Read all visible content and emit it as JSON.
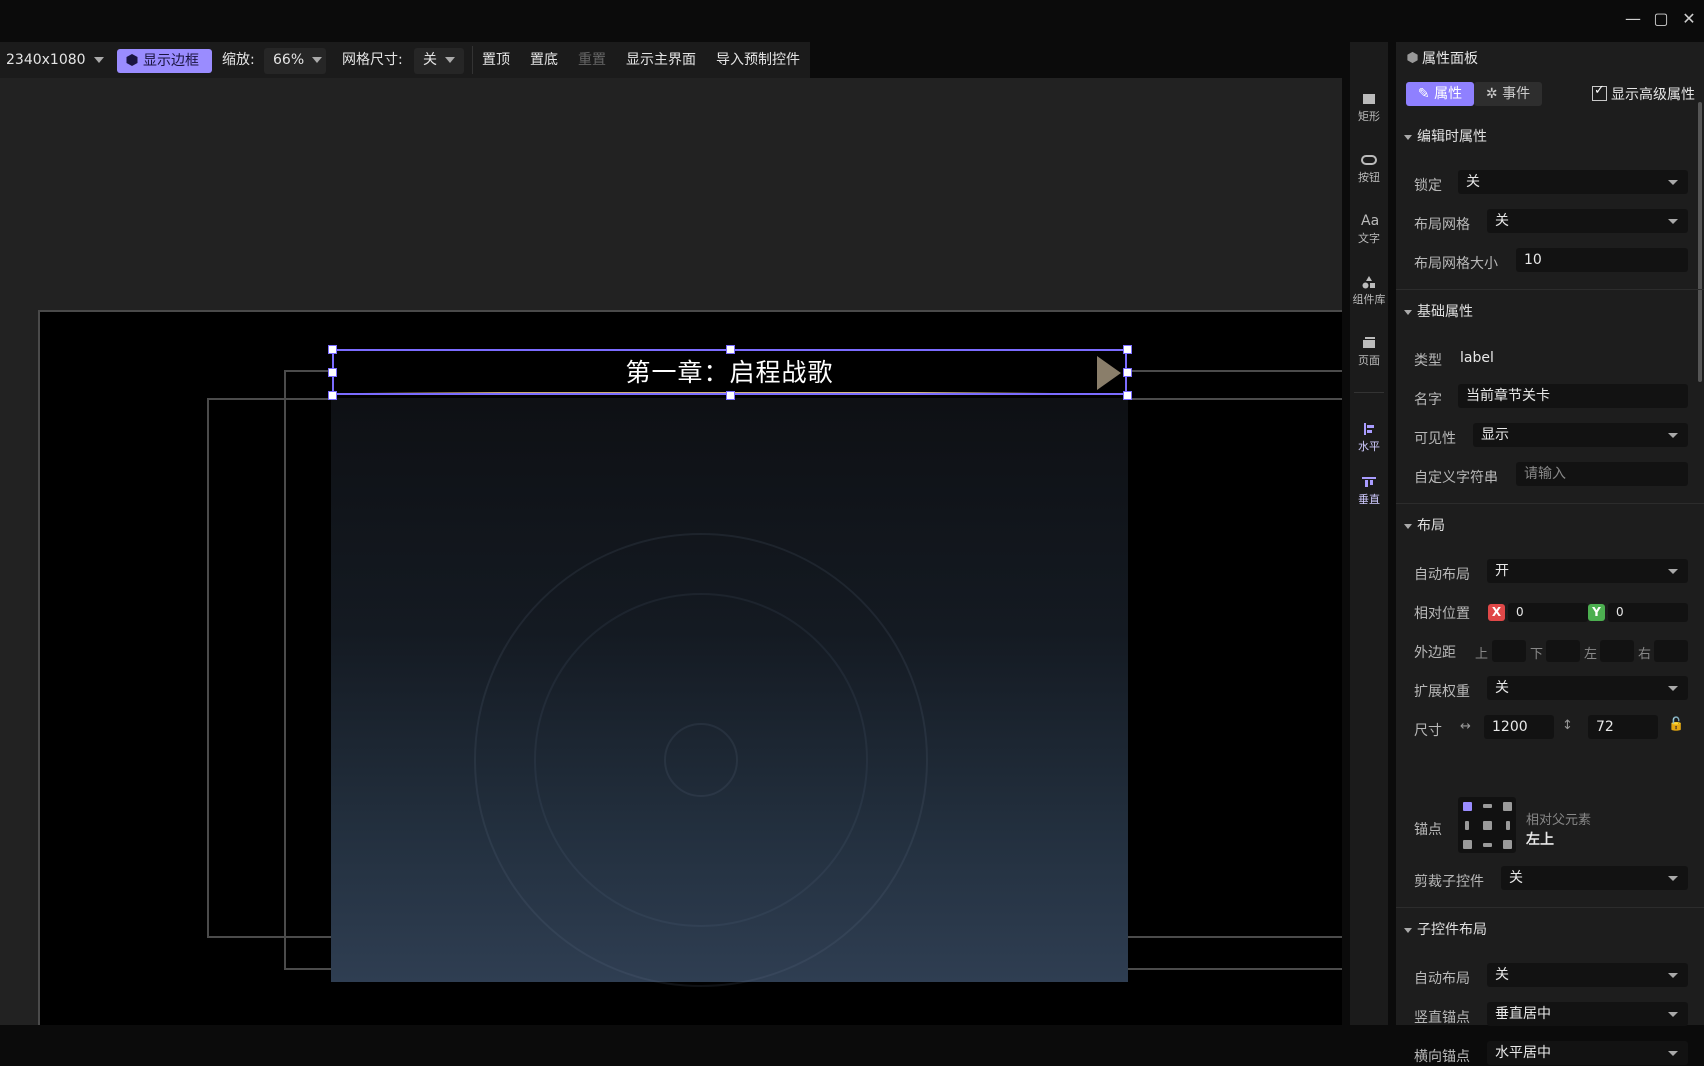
{
  "window": {
    "minimize": "—",
    "maximize": "▢",
    "close": "✕"
  },
  "toolbar": {
    "resolution": "2340x1080",
    "show_border": "显示边框",
    "zoom_label": "缩放:",
    "zoom_value": "66%",
    "grid_label": "网格尺寸:",
    "grid_value": "关",
    "bring_top": "置顶",
    "send_bottom": "置底",
    "reset": "重置",
    "show_main": "显示主界面",
    "import_prefab": "导入预制控件"
  },
  "canvas": {
    "title": "第一章：启程战歌"
  },
  "rail": {
    "rect": "矩形",
    "button": "按钮",
    "text": "文字",
    "library": "组件库",
    "page": "页面",
    "horizontal": "水平",
    "vertical": "垂直"
  },
  "props": {
    "title": "属性面板",
    "tab_props": "属性",
    "tab_events": "事件",
    "show_advanced": "显示高级属性",
    "edit": {
      "heading": "编辑时属性",
      "lock_label": "锁定",
      "lock_value": "关",
      "grid_label": "布局网格",
      "grid_value": "关",
      "grid_size_label": "布局网格大小",
      "grid_size_value": "10"
    },
    "basic": {
      "heading": "基础属性",
      "type_label": "类型",
      "type_value": "label",
      "name_label": "名字",
      "name_value": "当前章节关卡",
      "visible_label": "可见性",
      "visible_value": "显示",
      "custom_label": "自定义字符串",
      "custom_placeholder": "请输入"
    },
    "layout": {
      "heading": "布局",
      "auto_label": "自动布局",
      "auto_value": "开",
      "pos_label": "相对位置",
      "x_badge": "X",
      "x_value": "0",
      "y_badge": "Y",
      "y_value": "0",
      "margin_label": "外边距",
      "top": "上",
      "bottom": "下",
      "left": "左",
      "right": "右",
      "weight_label": "扩展权重",
      "weight_value": "关",
      "size_label": "尺寸",
      "width": "1200",
      "height": "72",
      "anchor_label": "锚点",
      "anchor_caption": "相对父元素",
      "anchor_value": "左上",
      "clip_label": "剪裁子控件",
      "clip_value": "关"
    },
    "child": {
      "heading": "子控件布局",
      "auto_label": "自动布局",
      "auto_value": "关",
      "v_anchor_label": "竖直锚点",
      "v_anchor_value": "垂直居中",
      "h_anchor_label": "横向锚点",
      "h_anchor_value": "水平居中"
    }
  },
  "colors": {
    "accent": "#8f80ff",
    "x_badge": "#e04848",
    "y_badge": "#4caf50"
  }
}
